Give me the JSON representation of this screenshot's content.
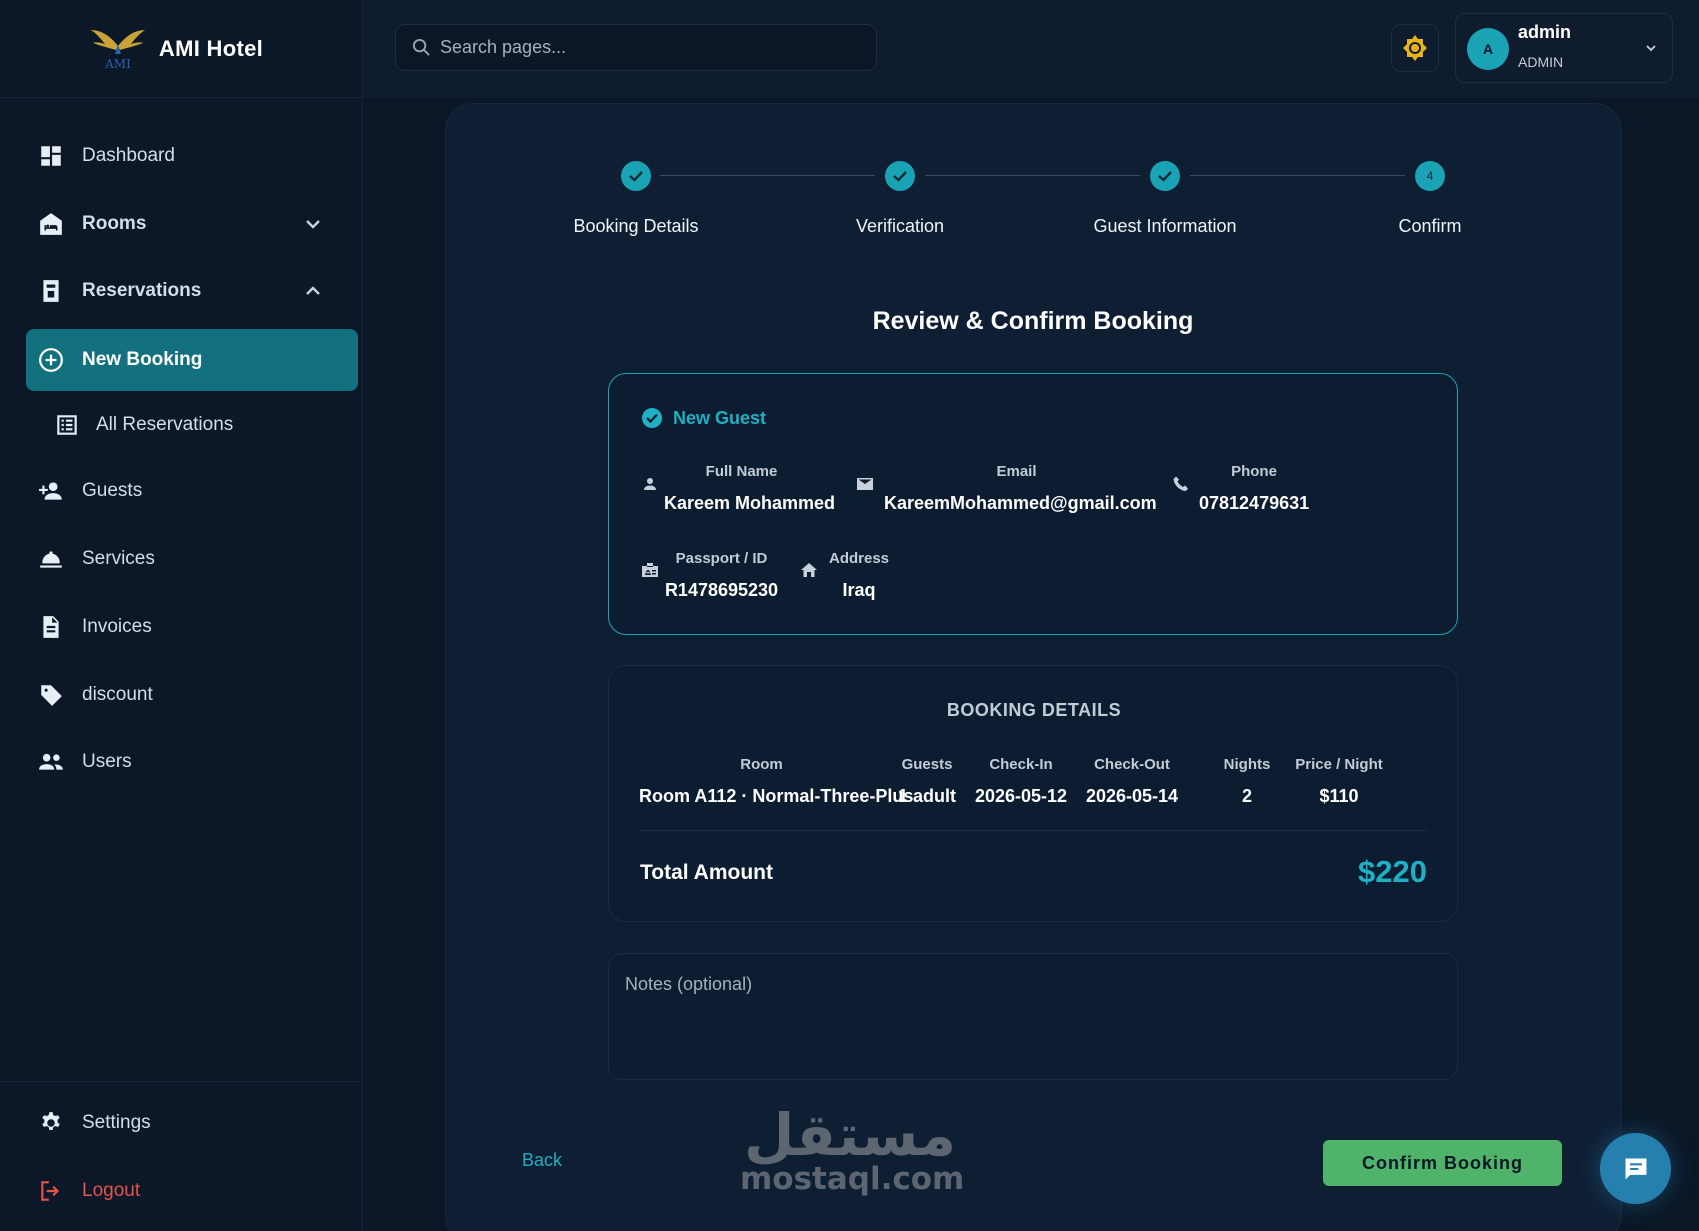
{
  "brand": {
    "name": "AMI Hotel",
    "logo_text": "AMI"
  },
  "search": {
    "placeholder": "Search pages..."
  },
  "user": {
    "initial": "A",
    "name": "admin",
    "role": "ADMIN"
  },
  "sidebar": {
    "items": [
      {
        "label": "Dashboard",
        "icon": "dashboard-icon"
      },
      {
        "label": "Rooms",
        "icon": "bed-icon"
      },
      {
        "label": "Reservations",
        "icon": "reservation-icon"
      },
      {
        "label": "New Booking",
        "icon": "plus-circle-icon"
      },
      {
        "label": "All Reservations",
        "icon": "list-icon"
      },
      {
        "label": "Guests",
        "icon": "add-person-icon"
      },
      {
        "label": "Services",
        "icon": "room-service-icon"
      },
      {
        "label": "Invoices",
        "icon": "document-icon"
      },
      {
        "label": "discount",
        "icon": "tag-icon"
      },
      {
        "label": "Users",
        "icon": "people-icon"
      }
    ],
    "footer": [
      {
        "label": "Settings",
        "icon": "gear-icon"
      },
      {
        "label": "Logout",
        "icon": "logout-icon"
      }
    ]
  },
  "stepper": {
    "steps": [
      {
        "label": "Booking Details",
        "done": true
      },
      {
        "label": "Verification",
        "done": true
      },
      {
        "label": "Guest Information",
        "done": true
      },
      {
        "label": "Confirm",
        "done": false,
        "number": "4"
      }
    ]
  },
  "page": {
    "title": "Review & Confirm Booking"
  },
  "guest": {
    "header": "New Guest",
    "full_name_label": "Full Name",
    "full_name": "Kareem Mohammed",
    "email_label": "Email",
    "email": "KareemMohammed@gmail.com",
    "phone_label": "Phone",
    "phone": "07812479631",
    "passport_label": "Passport / ID",
    "passport": "R1478695230",
    "address_label": "Address",
    "address": "Iraq"
  },
  "booking": {
    "title": "BOOKING DETAILS",
    "headers": {
      "room": "Room",
      "guests": "Guests",
      "checkin": "Check-In",
      "checkout": "Check-Out",
      "nights": "Nights",
      "price": "Price / Night"
    },
    "values": {
      "room": "Room A112 · Normal-Three-Plus",
      "guests": "1 adult",
      "checkin": "2026-05-12",
      "checkout": "2026-05-14",
      "nights": "2",
      "price": "$110"
    },
    "total_label": "Total Amount",
    "total_value": "$220"
  },
  "notes": {
    "placeholder": "Notes (optional)"
  },
  "actions": {
    "back": "Back",
    "confirm": "Confirm Booking"
  },
  "watermark": {
    "arabic": "مستقل",
    "latin": "mostaql.com"
  },
  "colors": {
    "accent": "#1aa3b5",
    "active_nav": "#13717f",
    "confirm": "#4fb36a",
    "logout": "#e5534b",
    "theme_icon": "#e8b21a"
  }
}
